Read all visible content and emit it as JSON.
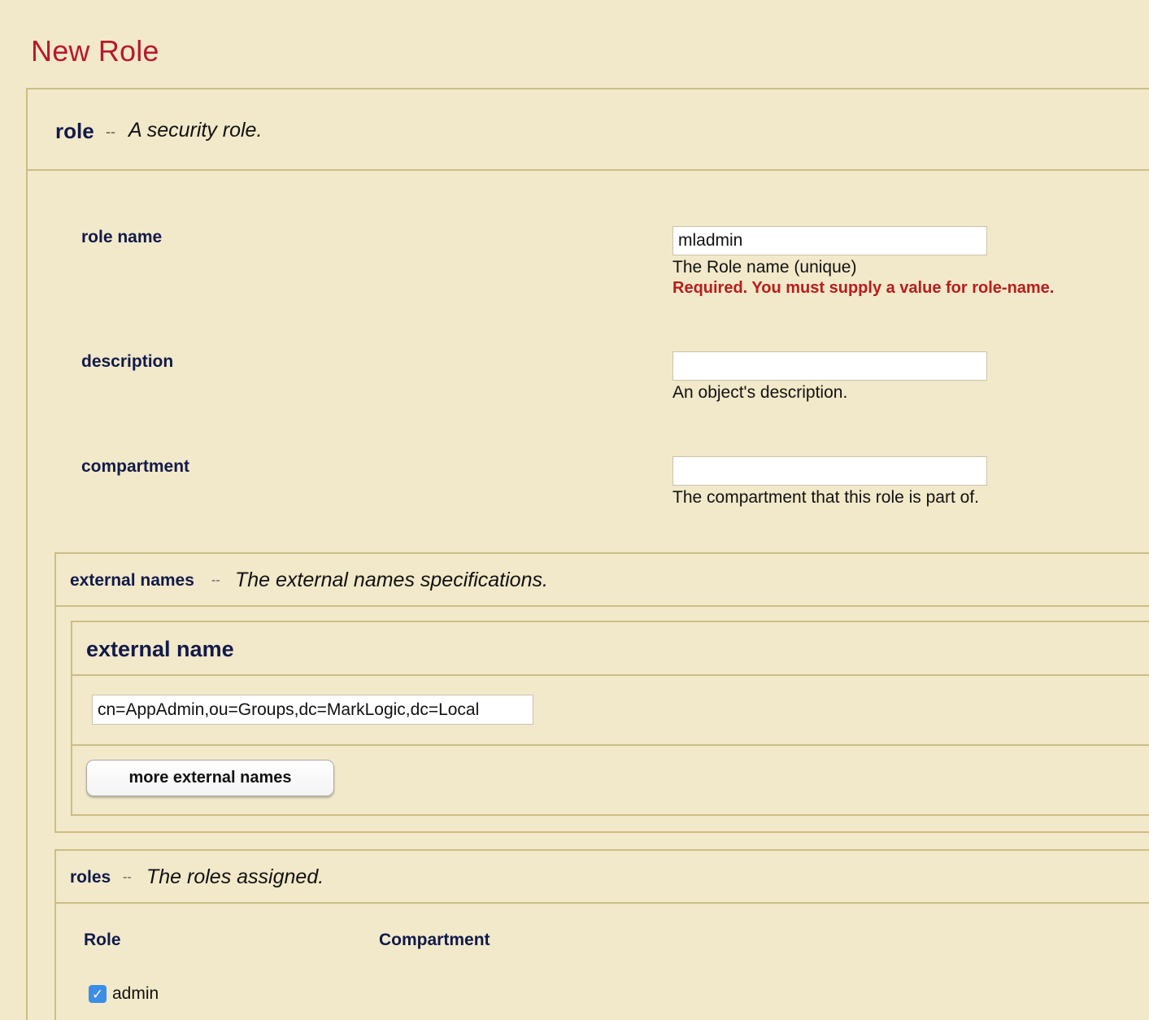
{
  "page": {
    "title": "New Role"
  },
  "role_section": {
    "name": "role",
    "separator": "--",
    "description": "A security role."
  },
  "fields": {
    "role_name": {
      "label": "role name",
      "value": "mladmin",
      "help": "The Role name (unique)",
      "error": "Required. You must supply a value for role-name."
    },
    "description": {
      "label": "description",
      "value": "",
      "help": "An object's description."
    },
    "compartment": {
      "label": "compartment",
      "value": "",
      "help": "The compartment that this role is part of."
    }
  },
  "external_names": {
    "name": "external names",
    "separator": "--",
    "description": "The external names specifications.",
    "item_title": "external name",
    "value": "cn=AppAdmin,ou=Groups,dc=MarkLogic,dc=Local",
    "more_button": "more external names"
  },
  "roles": {
    "name": "roles",
    "separator": "--",
    "description": "The roles assigned.",
    "columns": [
      "Role",
      "Compartment"
    ],
    "items": [
      {
        "label": "admin",
        "checked": true,
        "compartment": ""
      }
    ]
  },
  "colors": {
    "background": "#f2e9ca",
    "border": "#cdbd84",
    "title": "#b8182e",
    "label": "#121a4a",
    "error": "#b81d1d",
    "checkbox": "#3b8de8"
  }
}
